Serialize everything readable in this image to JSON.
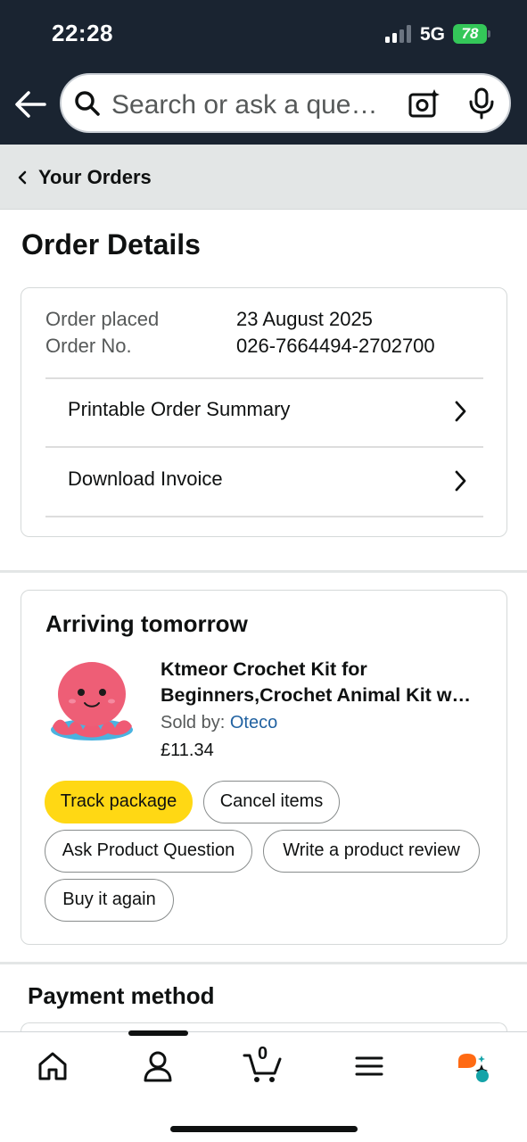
{
  "status_bar": {
    "time": "22:28",
    "network": "5G",
    "battery": "78"
  },
  "search": {
    "placeholder": "Search or ask a que…"
  },
  "breadcrumb": {
    "label": "Your Orders"
  },
  "page_title": "Order Details",
  "order": {
    "placed_label": "Order placed",
    "placed_value": "23 August 2025",
    "number_label": "Order No.",
    "number_value": "026-7664494-2702700",
    "links": [
      {
        "label": "Printable Order Summary"
      },
      {
        "label": "Download Invoice"
      }
    ]
  },
  "shipment": {
    "status": "Arriving tomorrow",
    "product_title_line1": "Ktmeor Crochet Kit for",
    "product_title_line2": "Beginners,Crochet Animal Kit w…",
    "sold_by_label": "Sold by:",
    "seller": "Oteco",
    "price": "£11.34",
    "actions": {
      "track": "Track package",
      "cancel": "Cancel items",
      "ask": "Ask Product Question",
      "review": "Write a product review",
      "buy_again": "Buy it again"
    }
  },
  "payment": {
    "title": "Payment method"
  },
  "bottom_nav": {
    "cart_count": "0",
    "items": [
      "home-icon",
      "account-icon",
      "cart-icon",
      "menu-icon",
      "rufus-icon"
    ]
  },
  "colors": {
    "header_bg": "#1a2431",
    "primary_button": "#ffd814",
    "link": "#2162a1",
    "battery": "#34c759"
  }
}
